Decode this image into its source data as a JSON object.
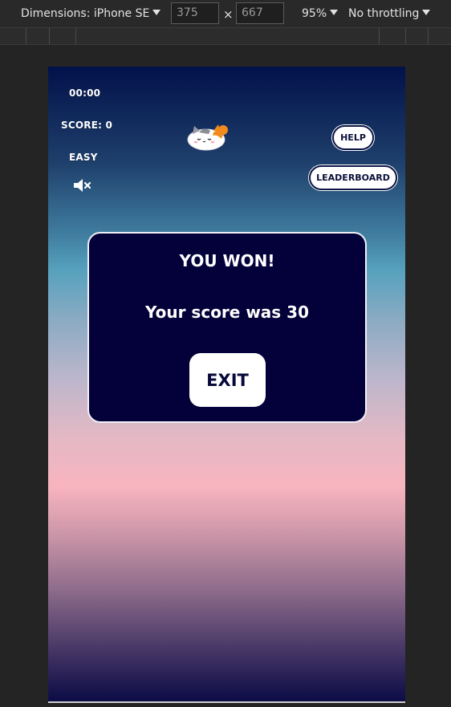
{
  "devtools": {
    "dimensions_label": "Dimensions: iPhone SE",
    "width_value": "375",
    "height_value": "667",
    "times": "×",
    "zoom": "95%",
    "throttling": "No throttling"
  },
  "game": {
    "timer": "00:00",
    "score": "SCORE: 0",
    "difficulty": "EASY",
    "help_label": "HELP",
    "leaderboard_label": "LEADERBOARD",
    "mute_icon": "speaker-muted-icon",
    "mascot_icon": "cat-mascot"
  },
  "modal": {
    "title": "YOU WON!",
    "score_text": "Your score was 30",
    "exit_label": "EXIT"
  },
  "colors": {
    "modal_bg": "#03003a",
    "button_text": "#0a0f3b",
    "sky_top": "#02114a",
    "sky_pink": "#f8b4bf"
  }
}
